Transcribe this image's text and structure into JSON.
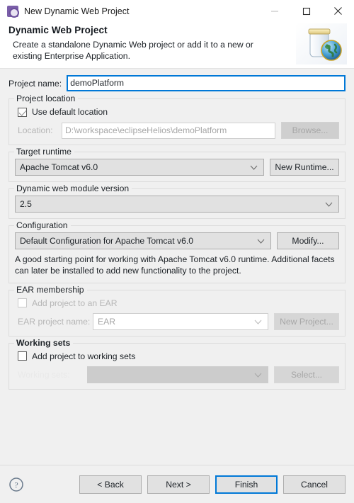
{
  "window": {
    "title": "New Dynamic Web Project",
    "app_icon": "eclipse-wizard-icon",
    "minimize_label": "Minimize",
    "maximize_label": "Maximize",
    "close_label": "Close"
  },
  "header": {
    "title": "Dynamic Web Project",
    "description": "Create a standalone Dynamic Web project or add it to a new or existing Enterprise Application.",
    "graphic": "jar-globe-icon"
  },
  "project_name": {
    "label": "Project name:",
    "value": "demoPlatform",
    "placeholder": ""
  },
  "project_location": {
    "group_title": "Project location",
    "use_default_label": "Use default location",
    "use_default_checked": true,
    "location_label": "Location:",
    "location_value": "D:\\workspace\\eclipseHelios\\demoPlatform",
    "browse_label": "Browse..."
  },
  "target_runtime": {
    "group_title": "Target runtime",
    "value": "Apache Tomcat v6.0",
    "new_runtime_label": "New Runtime..."
  },
  "module_version": {
    "group_title": "Dynamic web module version",
    "value": "2.5"
  },
  "configuration": {
    "group_title": "Configuration",
    "value": "Default Configuration for Apache Tomcat v6.0",
    "modify_label": "Modify...",
    "description": "A good starting point for working with Apache Tomcat v6.0 runtime. Additional facets can later be installed to add new functionality to the project."
  },
  "ear_membership": {
    "group_title": "EAR membership",
    "add_to_ear_label": "Add project to an EAR",
    "add_to_ear_checked": false,
    "ear_project_label": "EAR project name:",
    "ear_project_value": "EAR",
    "new_project_label": "New Project..."
  },
  "working_sets": {
    "group_title": "Working sets",
    "add_to_working_sets_label": "Add project to working sets",
    "add_to_working_sets_checked": false,
    "working_sets_label": "Working sets:",
    "working_sets_value": "",
    "select_label": "Select..."
  },
  "footer": {
    "help_icon": "question-mark-icon",
    "back_label": "< Back",
    "next_label": "Next >",
    "finish_label": "Finish",
    "cancel_label": "Cancel"
  },
  "colors": {
    "focus_blue": "#0078d7",
    "dialog_bg": "#f0f0f0",
    "banner_bg": "#ffffff",
    "disabled_text": "#a6a6a6"
  }
}
